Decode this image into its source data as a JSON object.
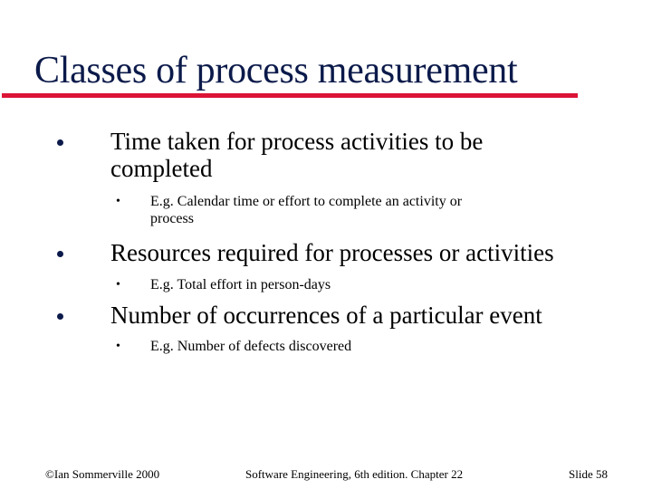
{
  "slide": {
    "title": "Classes of process measurement",
    "bullets": [
      {
        "text_line1": "Time taken for process activities to be",
        "text_line2": "completed",
        "sub": {
          "line1": "E.g. Calendar time or effort to complete an activity or",
          "line2": "process"
        }
      },
      {
        "text_line1": "Resources required for processes or activities",
        "sub": {
          "line1": "E.g. Total effort in person-days"
        }
      },
      {
        "text_line1": "Number of occurrences of a particular event",
        "sub": {
          "line1": "E.g. Number of defects discovered"
        }
      }
    ],
    "sub_bullet_glyph": "•"
  },
  "footer": {
    "copyright": "©Ian Sommerville 2000",
    "book": "Software Engineering, 6th edition. Chapter 22",
    "slide_number": "Slide 58"
  },
  "colors": {
    "title": "#0b1a4a",
    "rule": "#dc1435"
  }
}
